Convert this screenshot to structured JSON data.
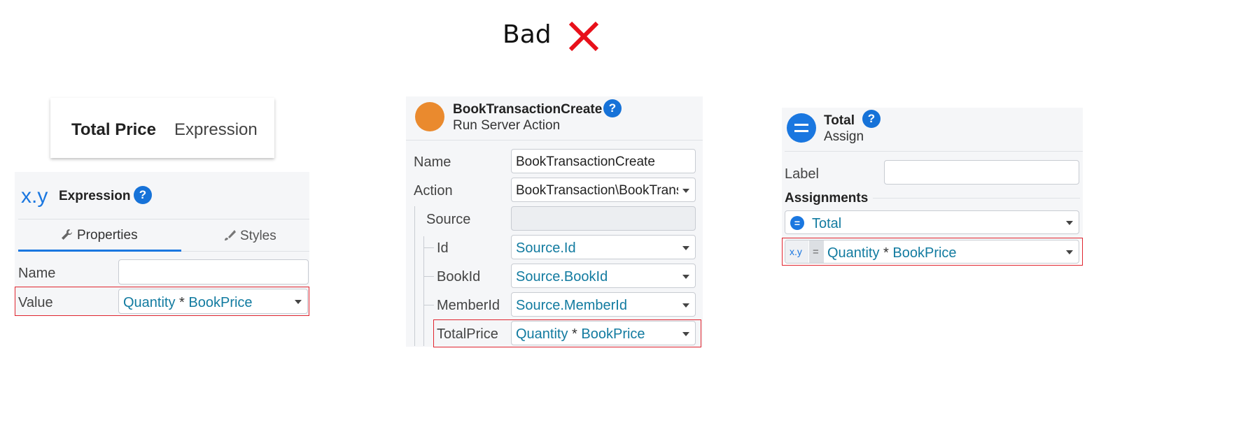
{
  "header": {
    "title": "Bad",
    "mark": "✕"
  },
  "panel1": {
    "card": {
      "bold": "Total Price",
      "light": "Expression"
    },
    "head": {
      "icon": "x.y",
      "title": "Expression",
      "help": "?"
    },
    "tabs": {
      "properties": "Properties",
      "styles": "Styles"
    },
    "fields": {
      "name_label": "Name",
      "name_value": "",
      "value_label": "Value",
      "value": {
        "left": "Quantity",
        "op": "*",
        "right": "BookPrice"
      }
    }
  },
  "panel2": {
    "head": {
      "title": "BookTransactionCreate",
      "subtitle": "Run Server Action",
      "help": "?"
    },
    "fields": {
      "name_label": "Name",
      "name_value": "BookTransactionCreate",
      "action_label": "Action",
      "action_value": "BookTransaction\\BookTrans",
      "source_label": "Source",
      "id_label": "Id",
      "id_value": "Source.Id",
      "bookid_label": "BookId",
      "bookid_value": "Source.BookId",
      "memberid_label": "MemberId",
      "memberid_value": "Source.MemberId",
      "totalprice_label": "TotalPrice",
      "totalprice_value": {
        "left": "Quantity",
        "op": "*",
        "right": "BookPrice"
      }
    }
  },
  "panel3": {
    "head": {
      "title": "Total",
      "subtitle": "Assign",
      "help": "?"
    },
    "fields": {
      "label_label": "Label",
      "label_value": "",
      "assignments_header": "Assignments",
      "var_icon": "=",
      "var_value": "Total",
      "expr_icon": "x.y",
      "expr_eq": "=",
      "expr_value": {
        "left": "Quantity",
        "op": "*",
        "right": "BookPrice"
      }
    }
  },
  "colors": {
    "accent": "#1672d8",
    "value_text": "#127ba0",
    "highlight": "#e0252f",
    "bad_mark": "#e8101a",
    "server_action": "#ea8a2e"
  }
}
